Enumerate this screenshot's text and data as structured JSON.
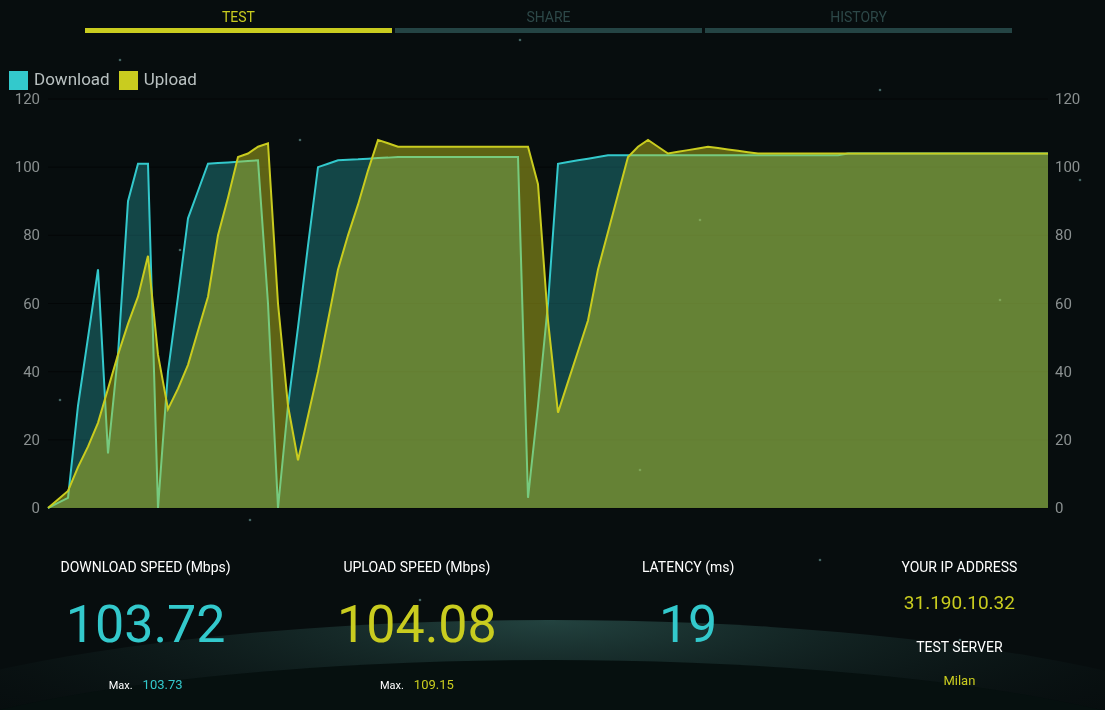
{
  "tabs": [
    {
      "label": "TEST",
      "selected": true
    },
    {
      "label": "SHARE",
      "selected": false
    },
    {
      "label": "HISTORY",
      "selected": false
    }
  ],
  "chart_data": {
    "type": "area",
    "grid": true,
    "ylim": [
      0,
      120
    ],
    "yticks": [
      0,
      20,
      40,
      60,
      80,
      100,
      120
    ],
    "y2ticks": [
      0,
      20,
      40,
      60,
      80,
      100,
      120
    ],
    "y2lim": [
      0,
      120
    ],
    "categories": [
      null,
      null,
      null,
      null,
      null,
      null,
      null,
      null,
      null,
      null,
      null,
      null,
      null,
      null,
      null,
      null,
      null,
      null,
      null,
      null,
      null,
      null,
      null,
      null,
      null,
      null,
      null,
      null,
      null,
      null,
      null,
      null,
      null,
      null,
      null,
      null,
      null,
      null,
      null,
      null,
      null,
      null,
      null,
      null,
      null,
      null,
      null,
      null,
      null,
      null,
      null,
      null,
      null,
      null,
      null,
      null,
      null,
      null,
      null,
      null,
      null,
      null,
      null,
      null,
      null,
      null,
      null,
      null,
      null,
      null,
      null,
      null,
      null,
      null,
      null,
      null,
      null,
      null,
      null,
      null,
      null,
      null,
      null,
      null,
      null,
      null,
      null,
      null,
      null,
      null,
      null,
      null,
      null,
      null,
      null,
      null,
      null,
      null,
      null,
      null,
      null
    ],
    "series": [
      {
        "name": "Download",
        "color": "#33c9cc",
        "values": [
          0,
          1.5,
          3,
          30,
          50,
          70,
          16,
          45,
          90,
          101,
          101,
          0,
          40,
          62,
          85,
          93,
          101,
          101.2,
          101.4,
          101.6,
          101.8,
          102,
          60,
          0,
          30,
          53,
          77,
          100,
          101,
          102,
          102.2,
          102.3,
          102.5,
          102.7,
          102.8,
          103,
          103,
          103,
          103,
          103,
          103,
          103,
          103,
          103,
          103,
          103,
          103,
          103,
          3,
          30,
          60,
          101,
          101.5,
          102,
          102.5,
          103,
          103.5,
          103.5,
          103.5,
          103.5,
          103.5,
          103.5,
          103.5,
          103.5,
          103.5,
          103.5,
          103.5,
          103.5,
          103.5,
          103.5,
          103.5,
          103.5,
          103.5,
          103.5,
          103.5,
          103.5,
          103.5,
          103.5,
          103.5,
          103.5,
          104,
          104,
          104,
          104,
          104,
          104,
          104,
          104,
          104,
          104,
          104,
          104,
          104,
          104,
          104,
          104,
          104,
          104,
          104,
          104,
          104
        ]
      },
      {
        "name": "Upload",
        "color": "#c9cc1f",
        "values": [
          0,
          2.5,
          5,
          12,
          18,
          25,
          35,
          45,
          54,
          62,
          74,
          45,
          29,
          35,
          42,
          52,
          62,
          80,
          91,
          103,
          104,
          106,
          107,
          60,
          30,
          14,
          27,
          40,
          55,
          70,
          80,
          89,
          99,
          108,
          107,
          106,
          106,
          106,
          106,
          106,
          106,
          106,
          106,
          106,
          106,
          106,
          106,
          106,
          106,
          95,
          55,
          28,
          37,
          46,
          55,
          70,
          81,
          92,
          103,
          106,
          108,
          106,
          104,
          104.5,
          105,
          105.5,
          106,
          105.6,
          105.2,
          104.8,
          104.4,
          104,
          104,
          104,
          104,
          104,
          104,
          104,
          104,
          104,
          104,
          104,
          104,
          104,
          104,
          104,
          104,
          104,
          104,
          104,
          104,
          104,
          104,
          104,
          104,
          104,
          104,
          104,
          104,
          104,
          104
        ]
      }
    ]
  },
  "stats": [
    {
      "label": "DOWNLOAD SPEED (Mbps)",
      "value": "103.72",
      "color": "#33c9cc",
      "max_label": "Max.",
      "max": "103.73"
    },
    {
      "label": "UPLOAD SPEED (Mbps)",
      "value": "104.08",
      "color": "#c9cc1f",
      "max_label": "Max.",
      "max": "109.15"
    },
    {
      "label": "LATENCY (ms)",
      "value": "19",
      "color": "#33c9cc"
    }
  ],
  "info": [
    {
      "label": "YOUR IP ADDRESS",
      "value": "31.190.10.32"
    },
    {
      "label": "TEST SERVER",
      "value": "Milan"
    }
  ]
}
